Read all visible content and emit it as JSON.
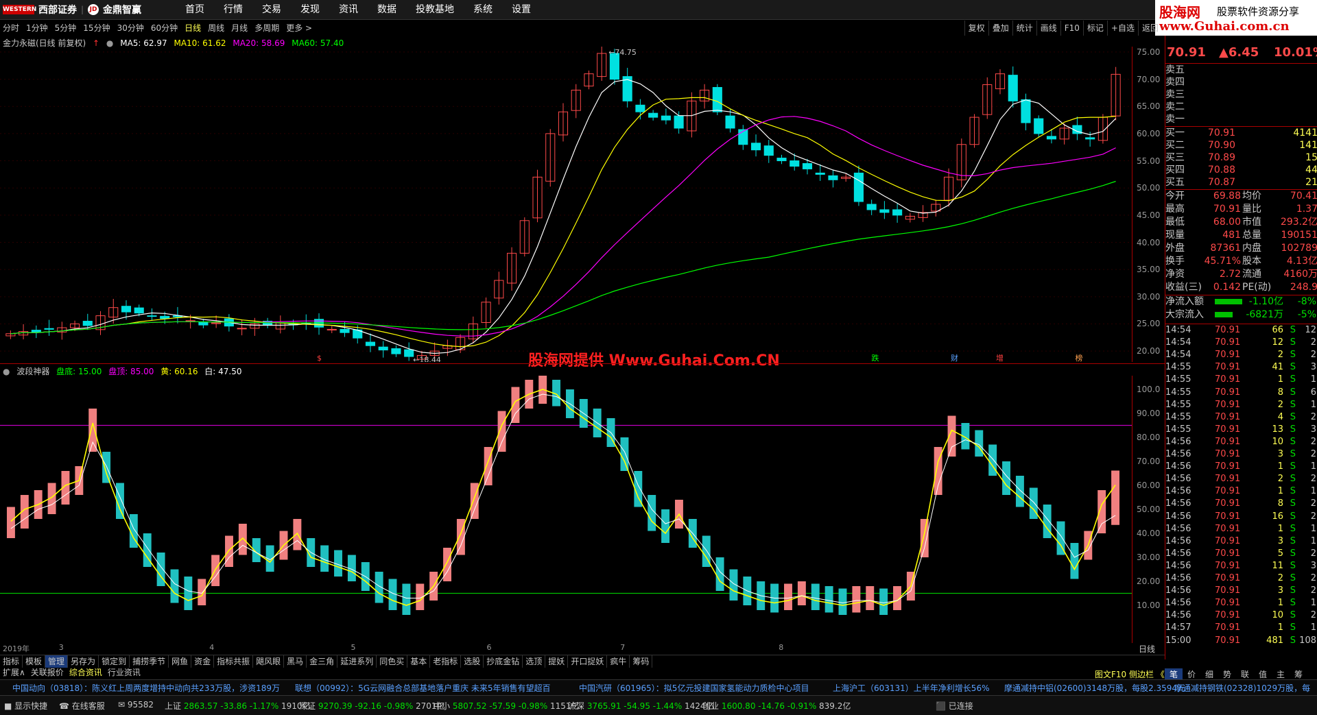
{
  "topbar": {
    "logo_text": "西部证券",
    "partner_text": "金鼎智赢",
    "menu": [
      "首页",
      "行情",
      "交易",
      "发现",
      "资讯",
      "数据",
      "投教基地",
      "系统",
      "设置"
    ]
  },
  "brand": {
    "line1": "股海网",
    "line2": "股票软件资源分享",
    "line3": "www.Guhai.com.cn"
  },
  "periods": [
    "分时",
    "1分钟",
    "5分钟",
    "15分钟",
    "30分钟",
    "60分钟",
    "日线",
    "周线",
    "月线",
    "多周期",
    "更多 >"
  ],
  "active_period": "日线",
  "right_tools": [
    "复权",
    "叠加",
    "统计",
    "画线",
    "F10",
    "标记",
    "+自选",
    "返回"
  ],
  "main_legend": {
    "name": "金力永磁(日线 前复权)",
    "ma5": "MA5: 62.97",
    "ma10": "MA10: 61.62",
    "ma20": "MA20: 58.69",
    "ma60": "MA60: 57.40"
  },
  "sub_legend": {
    "name": "波段神器",
    "pandi": "盘底: 15.00",
    "panding": "盘顶: 85.00",
    "huang": "黄: 60.16",
    "bai": "白: 47.50"
  },
  "watermark": "股海网提供 Www.Guhai.Com.CN",
  "chart_labels": {
    "high": "74.75",
    "low": "18.44",
    "year": "2019年",
    "months": [
      "3",
      "4",
      "5",
      "6",
      "7",
      "8"
    ],
    "bottom_tag": "日线",
    "markers": [
      "$",
      "跌",
      "财",
      "增",
      "榜"
    ]
  },
  "main_axis": [
    "75.00",
    "70.00",
    "65.00",
    "60.00",
    "55.00",
    "50.00",
    "45.00",
    "40.00",
    "35.00",
    "30.00",
    "25.00",
    "20.00"
  ],
  "sub_axis": [
    "100.0",
    "90.00",
    "80.00",
    "70.00",
    "60.00",
    "50.00",
    "40.00",
    "30.00",
    "20.00",
    "10.00"
  ],
  "chart_data": [
    {
      "type": "candlestick",
      "title": "金力永磁(日线 前复权)",
      "ylim": [
        18,
        76
      ],
      "close_series_approx": [
        23.2,
        23.6,
        23.4,
        24.0,
        24.3,
        25.0,
        24.7,
        26.5,
        28.0,
        27.2,
        27.0,
        26.4,
        26.0,
        26.3,
        25.6,
        24.8,
        25.2,
        24.6,
        24.2,
        25.0,
        24.8,
        25.2,
        24.9,
        25.1,
        24.4,
        24.0,
        23.4,
        22.4,
        21.0,
        20.2,
        19.5,
        19.0,
        19.2,
        20.0,
        21.0,
        22.5,
        25.0,
        29.0,
        33.0,
        38.0,
        44.0,
        52.0,
        60.0,
        64.0,
        68.0,
        71.0,
        74.75,
        70.0,
        66.0,
        64.0,
        63.0,
        62.5,
        61.0,
        66.0,
        68.0,
        64.0,
        61.0,
        58.0,
        57.0,
        56.0,
        55.0,
        54.0,
        53.5,
        52.5,
        51.5,
        52.0,
        47.5,
        46.0,
        45.5,
        45.0,
        44.8,
        45.5,
        47.0,
        52.0,
        58.0,
        63.0,
        69.0,
        71.0,
        66.0,
        62.0,
        60.0,
        59.0,
        61.0,
        60.0,
        59.0,
        63.0,
        70.91
      ],
      "ma_lines": [
        "MA5",
        "MA10",
        "MA20",
        "MA60"
      ],
      "high": 74.75,
      "low": 18.44
    },
    {
      "type": "line",
      "title": "波段神器",
      "ylim": [
        0,
        100
      ],
      "reference_lines": [
        15,
        85
      ],
      "series": [
        {
          "name": "黄",
          "values": [
            45,
            50,
            52,
            55,
            60,
            62,
            86,
            65,
            50,
            38,
            30,
            22,
            15,
            12,
            14,
            25,
            33,
            38,
            32,
            28,
            35,
            40,
            30,
            28,
            26,
            24,
            20,
            15,
            12,
            10,
            12,
            18,
            28,
            40,
            55,
            70,
            85,
            95,
            98,
            100,
            98,
            92,
            88,
            84,
            80,
            70,
            55,
            45,
            40,
            48,
            38,
            30,
            20,
            16,
            14,
            12,
            11,
            12,
            14,
            12,
            11,
            10,
            11,
            12,
            10,
            12,
            18,
            40,
            70,
            83,
            80,
            76,
            68,
            60,
            55,
            50,
            42,
            35,
            25,
            35,
            52,
            60.16
          ]
        },
        {
          "name": "白",
          "values": [
            42,
            46,
            50,
            52,
            56,
            60,
            78,
            68,
            55,
            42,
            34,
            26,
            19,
            16,
            15,
            22,
            30,
            35,
            32,
            29,
            33,
            37,
            32,
            29,
            27,
            25,
            22,
            18,
            15,
            13,
            13,
            16,
            24,
            35,
            50,
            64,
            78,
            90,
            96,
            98,
            97,
            94,
            90,
            86,
            82,
            74,
            60,
            50,
            44,
            46,
            40,
            33,
            24,
            19,
            16,
            14,
            13,
            13,
            14,
            13,
            12,
            11,
            12,
            12,
            11,
            12,
            16,
            34,
            60,
            76,
            79,
            77,
            71,
            64,
            58,
            53,
            46,
            39,
            30,
            33,
            44,
            47.5
          ]
        }
      ]
    }
  ],
  "quote": {
    "price": "70.91",
    "change": "▲6.45",
    "pct": "10.01%",
    "asks": [
      {
        "l": "卖五",
        "p": "",
        "v": ""
      },
      {
        "l": "卖四",
        "p": "",
        "v": ""
      },
      {
        "l": "卖三",
        "p": "",
        "v": ""
      },
      {
        "l": "卖二",
        "p": "",
        "v": ""
      },
      {
        "l": "卖一",
        "p": "",
        "v": ""
      }
    ],
    "bids": [
      {
        "l": "买一",
        "p": "70.91",
        "v": "4141"
      },
      {
        "l": "买二",
        "p": "70.90",
        "v": "141"
      },
      {
        "l": "买三",
        "p": "70.89",
        "v": "15"
      },
      {
        "l": "买四",
        "p": "70.88",
        "v": "44"
      },
      {
        "l": "买五",
        "p": "70.87",
        "v": "21"
      }
    ],
    "stats": [
      {
        "a": "今开",
        "b": "69.88",
        "c": "均价",
        "d": "70.41"
      },
      {
        "a": "最高",
        "b": "70.91",
        "c": "量比",
        "d": "1.37"
      },
      {
        "a": "最低",
        "b": "68.00",
        "c": "市值",
        "d": "293.2亿"
      },
      {
        "a": "现量",
        "b": "481",
        "c": "总量",
        "d": "190151"
      },
      {
        "a": "外盘",
        "b": "87361",
        "c": "内盘",
        "d": "102789"
      },
      {
        "a": "换手",
        "b": "45.71%",
        "c": "股本",
        "d": "4.13亿"
      },
      {
        "a": "净资",
        "b": "2.72",
        "c": "流通",
        "d": "4160万"
      },
      {
        "a": "收益(三)",
        "b": "0.142",
        "c": "PE(动)",
        "d": "248.9"
      }
    ],
    "flows": [
      {
        "a": "净流入额",
        "b": "-1.10亿",
        "c": "-8%"
      },
      {
        "a": "大宗流入",
        "b": "-6821万",
        "c": "-5%"
      }
    ],
    "ticks": [
      {
        "t": "14:54",
        "p": "70.91",
        "v": "66",
        "s": "S",
        "n": "12"
      },
      {
        "t": "14:54",
        "p": "70.91",
        "v": "12",
        "s": "S",
        "n": "2"
      },
      {
        "t": "14:54",
        "p": "70.91",
        "v": "2",
        "s": "S",
        "n": "2"
      },
      {
        "t": "14:55",
        "p": "70.91",
        "v": "41",
        "s": "S",
        "n": "3"
      },
      {
        "t": "14:55",
        "p": "70.91",
        "v": "1",
        "s": "S",
        "n": "1"
      },
      {
        "t": "14:55",
        "p": "70.91",
        "v": "8",
        "s": "S",
        "n": "6"
      },
      {
        "t": "14:55",
        "p": "70.91",
        "v": "2",
        "s": "S",
        "n": "1"
      },
      {
        "t": "14:55",
        "p": "70.91",
        "v": "4",
        "s": "S",
        "n": "2"
      },
      {
        "t": "14:55",
        "p": "70.91",
        "v": "13",
        "s": "S",
        "n": "3"
      },
      {
        "t": "14:56",
        "p": "70.91",
        "v": "10",
        "s": "S",
        "n": "2"
      },
      {
        "t": "14:56",
        "p": "70.91",
        "v": "3",
        "s": "S",
        "n": "2"
      },
      {
        "t": "14:56",
        "p": "70.91",
        "v": "1",
        "s": "S",
        "n": "1"
      },
      {
        "t": "14:56",
        "p": "70.91",
        "v": "2",
        "s": "S",
        "n": "2"
      },
      {
        "t": "14:56",
        "p": "70.91",
        "v": "1",
        "s": "S",
        "n": "1"
      },
      {
        "t": "14:56",
        "p": "70.91",
        "v": "8",
        "s": "S",
        "n": "2"
      },
      {
        "t": "14:56",
        "p": "70.91",
        "v": "16",
        "s": "S",
        "n": "2"
      },
      {
        "t": "14:56",
        "p": "70.91",
        "v": "1",
        "s": "S",
        "n": "1"
      },
      {
        "t": "14:56",
        "p": "70.91",
        "v": "3",
        "s": "S",
        "n": "1"
      },
      {
        "t": "14:56",
        "p": "70.91",
        "v": "5",
        "s": "S",
        "n": "2"
      },
      {
        "t": "14:56",
        "p": "70.91",
        "v": "11",
        "s": "S",
        "n": "3"
      },
      {
        "t": "14:56",
        "p": "70.91",
        "v": "2",
        "s": "S",
        "n": "2"
      },
      {
        "t": "14:56",
        "p": "70.91",
        "v": "3",
        "s": "S",
        "n": "2"
      },
      {
        "t": "14:56",
        "p": "70.91",
        "v": "1",
        "s": "S",
        "n": "1"
      },
      {
        "t": "14:56",
        "p": "70.91",
        "v": "10",
        "s": "S",
        "n": "2"
      },
      {
        "t": "14:57",
        "p": "70.91",
        "v": "1",
        "s": "S",
        "n": "1"
      },
      {
        "t": "15:00",
        "p": "70.91",
        "v": "481",
        "s": "S",
        "n": "108"
      }
    ],
    "bottom_tabs": [
      "笔",
      "价",
      "细",
      "势",
      "联",
      "值",
      "主",
      "筹"
    ]
  },
  "tabs": [
    "指标",
    "模板",
    "管理",
    "另存为",
    "锁定到",
    "捕捞季节",
    "网鱼",
    "资金",
    "指标共振",
    "飓风眼",
    "黑马",
    "金三角",
    "延进系列",
    "同色买",
    "基本",
    "老指标",
    "选股",
    "抄底金钻",
    "选顶",
    "提妖",
    "开口捉妖",
    "疯牛",
    "筹码"
  ],
  "tabs2": [
    "扩展∧",
    "关联报价",
    "综合资讯",
    "行业资讯"
  ],
  "tabs2_right": "图文F10 侧边栏 《",
  "news": [
    "中国动向（03818）：陈义红上周两度增持中动向共233万股，涉资189万",
    "联想（00992）：5G云网融合总部基地落户重庆  未来5年销售有望超百",
    "中国汽研（601965）：拟5亿元投建国家氢能动力质检中心项目",
    "上海沪工（603131）上半年净利增长56%",
    "摩通减持中铝(02600)3148万股，每股2.3594元",
    "摩通减持钢铁(02328)1029万股，每"
  ],
  "status": {
    "quick": "显示快捷",
    "service": "在线客服",
    "phone": "95582",
    "indices": [
      {
        "name": "上证",
        "val": "2863.57",
        "chg": "-33.86",
        "pct": "-1.17%",
        "amt": "1910亿"
      },
      {
        "name": "深证",
        "val": "9270.39",
        "chg": "-92.16",
        "pct": "-0.98%",
        "amt": "2701亿"
      },
      {
        "name": "中小",
        "val": "5807.52",
        "chg": "-57.59",
        "pct": "-0.98%",
        "amt": "1151亿"
      },
      {
        "name": "沪深",
        "val": "3765.91",
        "chg": "-54.95",
        "pct": "-1.44%",
        "amt": "1424亿"
      },
      {
        "name": "创业",
        "val": "1600.80",
        "chg": "-14.76",
        "pct": "-0.91%",
        "amt": "839.2亿"
      }
    ],
    "conn": "已连接"
  },
  "colors": {
    "up": "#ff4a4a",
    "down": "#00e0e0",
    "accent": "#ffff54",
    "ma5": "#ffffff",
    "ma10": "#ffff00",
    "ma20": "#ff00ff",
    "ma60": "#00ff00",
    "axis": "#aa0000"
  }
}
